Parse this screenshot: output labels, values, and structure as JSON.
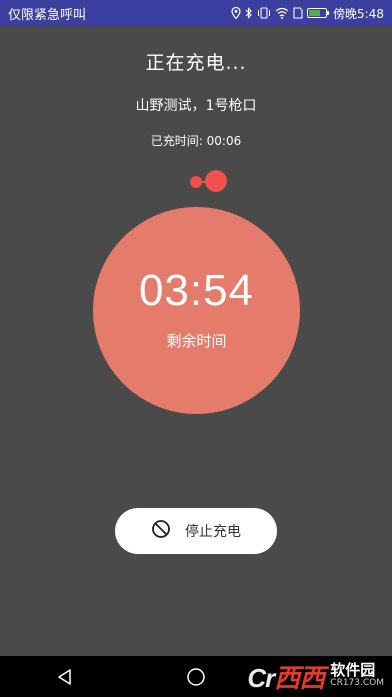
{
  "status_bar": {
    "notice": "仅限紧急呼叫",
    "time": "傍晚5:48",
    "icons": [
      "location-icon",
      "bluetooth-icon",
      "vibrate-icon",
      "wifi-icon",
      "sim-icon",
      "battery-icon"
    ],
    "background_color": "#3a3fa0"
  },
  "charging": {
    "title": "正在充电...",
    "station": "山野测试，1号枪口",
    "elapsed_label": "已充时间:",
    "elapsed_value": "00:06",
    "remaining_time": "03:54",
    "remaining_label": "剩余时间",
    "circle_color": "#e57c6b",
    "dot_color": "#f24f4f"
  },
  "actions": {
    "stop_label": "停止充电",
    "stop_icon": "prohibited-icon"
  },
  "navigation": {
    "items": [
      "back-icon",
      "home-icon",
      "recents-icon"
    ]
  },
  "watermark": {
    "logo": "Cr",
    "logo_accent": "西西",
    "name": "软件园",
    "domain": "CR173.COM"
  }
}
